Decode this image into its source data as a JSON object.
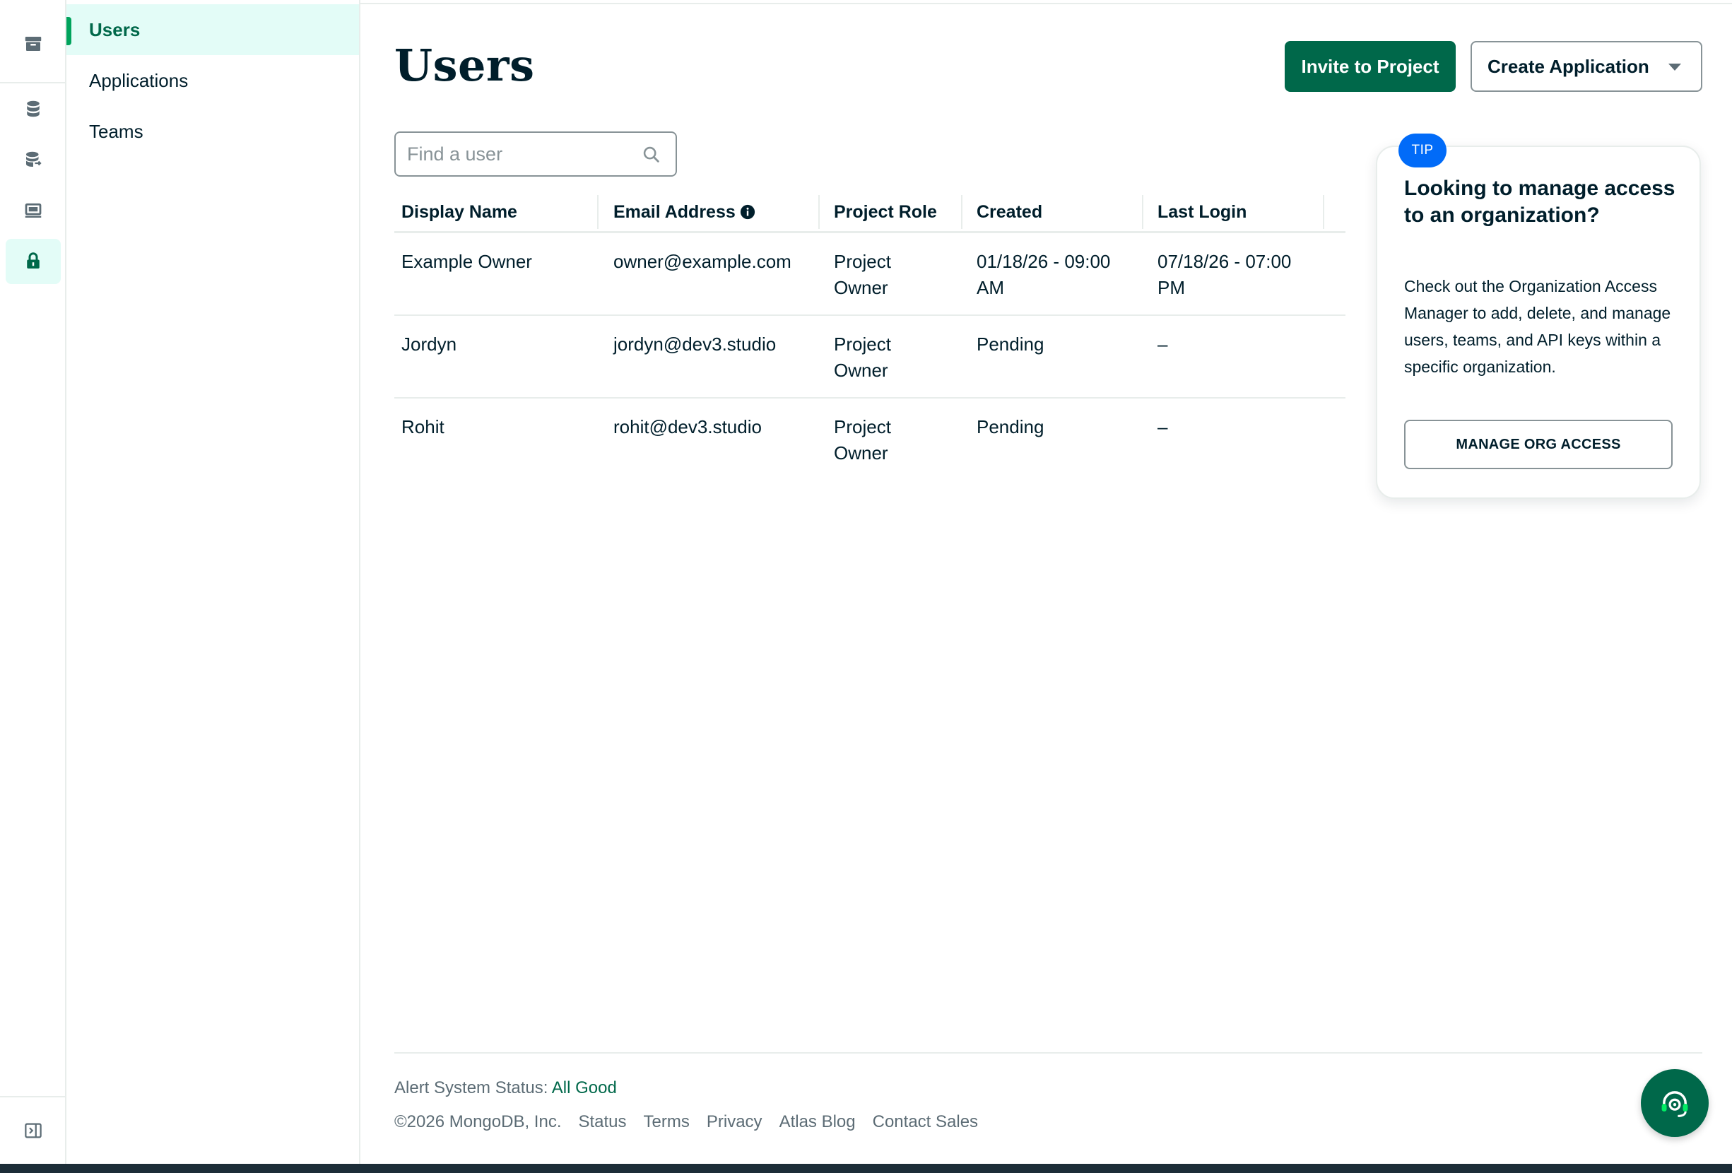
{
  "rail": {
    "items": [
      {
        "icon": "archive-icon",
        "active": false
      },
      {
        "icon": "database-icon",
        "active": false
      },
      {
        "icon": "database-transfer-icon",
        "active": false
      },
      {
        "icon": "monitor-icon",
        "active": false
      },
      {
        "icon": "lock-icon",
        "active": true
      }
    ],
    "collapse_icon": "sidebar-collapse-icon"
  },
  "subnav": {
    "items": [
      {
        "label": "Users",
        "active": true
      },
      {
        "label": "Applications",
        "active": false
      },
      {
        "label": "Teams",
        "active": false
      }
    ]
  },
  "header": {
    "title": "Users",
    "invite_label": "Invite to Project",
    "create_label": "Create Application"
  },
  "search": {
    "placeholder": "Find a user",
    "value": ""
  },
  "table": {
    "columns": [
      "Display Name",
      "Email Address",
      "Project Role",
      "Created",
      "Last Login"
    ],
    "rows": [
      {
        "name": "Example Owner",
        "email": "owner@example.com",
        "role_line1": "Project",
        "role_line2": "Owner",
        "created_line1": "01/18/26 - 09:00",
        "created_line2": "AM",
        "login_line1": "07/18/26 - 07:00",
        "login_line2": "PM"
      },
      {
        "name": "Jordyn",
        "email": "jordyn@dev3.studio",
        "role_line1": "Project",
        "role_line2": "Owner",
        "created_line1": "Pending",
        "created_line2": "",
        "login_line1": "–",
        "login_line2": ""
      },
      {
        "name": "Rohit",
        "email": "rohit@dev3.studio",
        "role_line1": "Project",
        "role_line2": "Owner",
        "created_line1": "Pending",
        "created_line2": "",
        "login_line1": "–",
        "login_line2": ""
      }
    ]
  },
  "tip": {
    "badge": "TIP",
    "title": "Looking to manage access to an organization?",
    "body": "Check out the Organization Access Manager to add, delete, and manage users, teams, and API keys within a specific organization.",
    "button": "MANAGE ORG ACCESS"
  },
  "footer": {
    "status_label": "Alert System Status:",
    "status_value": "All Good",
    "copyright": "©2026 MongoDB, Inc.",
    "links": [
      "Status",
      "Terms",
      "Privacy",
      "Atlas Blog",
      "Contact Sales"
    ]
  },
  "colors": {
    "brand_green": "#00684a",
    "active_bg": "#e3fcf7",
    "tip_blue": "#016bf8",
    "text": "#001e2b"
  }
}
